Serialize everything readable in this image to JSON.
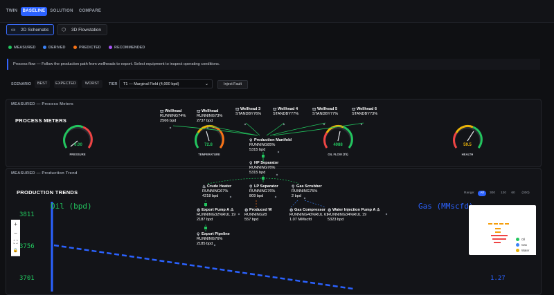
{
  "nav": {
    "tabs": [
      {
        "label": "TWIN",
        "active": false
      },
      {
        "label": "BASELINE",
        "active": true
      },
      {
        "label": "SOLUTION",
        "active": false
      },
      {
        "label": "COMPARE",
        "active": false
      }
    ]
  },
  "views": {
    "schematic_label": "2D Schematic",
    "flowstation_label": "3D Flowstation"
  },
  "legend": [
    {
      "label": "MEASURED",
      "color": "#22c55e"
    },
    {
      "label": "DERIVED",
      "color": "#3b82f6"
    },
    {
      "label": "PREDICTED",
      "color": "#f97316"
    },
    {
      "label": "RECOMMENDED",
      "color": "#a855f7"
    }
  ],
  "banner": "Process flow — Follow the production path from wellheads to export. Select equipment to inspect operating conditions.",
  "controls": {
    "scenario_label": "SCENARIO",
    "scenario_options": [
      "BEST",
      "EXPECTED",
      "WORST"
    ],
    "tier_label": "TIER",
    "tier_value": "T1 — Marginal Field (4,000 bpd)",
    "inject_fault": "Inject Fault"
  },
  "meters": {
    "section_label": "MEASURED — Process Meters",
    "title": "PROCESS METERS",
    "gauges": [
      {
        "label": "PRESSURE",
        "value": "0.00",
        "color": "#22c55e"
      },
      {
        "label": "TEMPERATURE",
        "value": "72.8",
        "color": "#22c55e"
      },
      {
        "label": "OIL FLOW (T/I)",
        "value": "4088",
        "color": "#22c55e"
      },
      {
        "label": "HEALTH",
        "value": "59.5",
        "color": "#eab308"
      }
    ]
  },
  "trend": {
    "section_label": "MEASURED — Production Trend",
    "title": "PRODUCTION TRENDS",
    "range_label": "Range:",
    "ranges": [
      "All",
      "300",
      "120",
      "60",
      "(300)"
    ],
    "oil_label": "Oil (bpd)",
    "gas_label": "Gas (MMscfd)",
    "y_ticks": [
      "3811",
      "3756",
      "3701"
    ],
    "gas_tick": "1.27",
    "minimap_legend": [
      "Oil",
      "Gas",
      "Water"
    ]
  },
  "chart_data": {
    "type": "line",
    "xlabel": "",
    "ylabel": "Oil (bpd)",
    "y2label": "Gas (MMscfd)",
    "y_ticks": [
      3811,
      3756,
      3701
    ],
    "series": [
      {
        "name": "Oil",
        "axis": "left",
        "color": "#2b62ff"
      },
      {
        "name": "Gas",
        "axis": "right",
        "color": "#2b62ff"
      }
    ]
  },
  "flow": {
    "wellheads": [
      {
        "name": "Wellhead",
        "status": "RUNNING74%",
        "rate": "2566 bpd"
      },
      {
        "name": "Wellhead",
        "status": "RUNNING73%",
        "rate": "2737 bpd"
      },
      {
        "name": "Wellhead 3",
        "status": "STANDBY76%",
        "rate": ""
      },
      {
        "name": "Wellhead 4",
        "status": "STANDBY77%",
        "rate": ""
      },
      {
        "name": "Wellhead 5",
        "status": "STANDBY77%",
        "rate": ""
      },
      {
        "name": "Wellhead 6",
        "status": "STANDBY73%",
        "rate": ""
      }
    ],
    "manifold": {
      "name": "Production Manifold",
      "status": "RUNNING85%",
      "rate": "5315 bpd"
    },
    "hp_separator": {
      "name": "HP Separator",
      "status": "RUNNING76%",
      "rate": "5315 bpd"
    },
    "crude_heater": {
      "name": "Crude Heater",
      "status": "RUNNING67%",
      "rate": "4218 bpd"
    },
    "lp_separator": {
      "name": "LP Separator",
      "status": "RUNNING76%",
      "rate": "809 bpd"
    },
    "gas_scrubber": {
      "name": "Gas Scrubber",
      "status": "RUNNING75%",
      "rate": "2 bpd"
    },
    "export_pump": {
      "name": "Export Pump A",
      "status": "RUNNING32%RUL 19",
      "rate": "2187 bpd"
    },
    "produced_water": {
      "name": "Produced W",
      "status": "RUNNING28",
      "rate": "557 bpd"
    },
    "gas_compressor": {
      "name": "Gas Compressor",
      "status": "RUNNING40%RUL 61",
      "rate": "1.07 MMscfd"
    },
    "water_injection": {
      "name": "Water Injection Pump A",
      "status": "RUNNING34%RUL 19",
      "rate": "5323 bpd"
    },
    "export_pipeline": {
      "name": "Export Pipeline",
      "status": "RUNNING76%",
      "rate": "2185 bpd"
    }
  }
}
